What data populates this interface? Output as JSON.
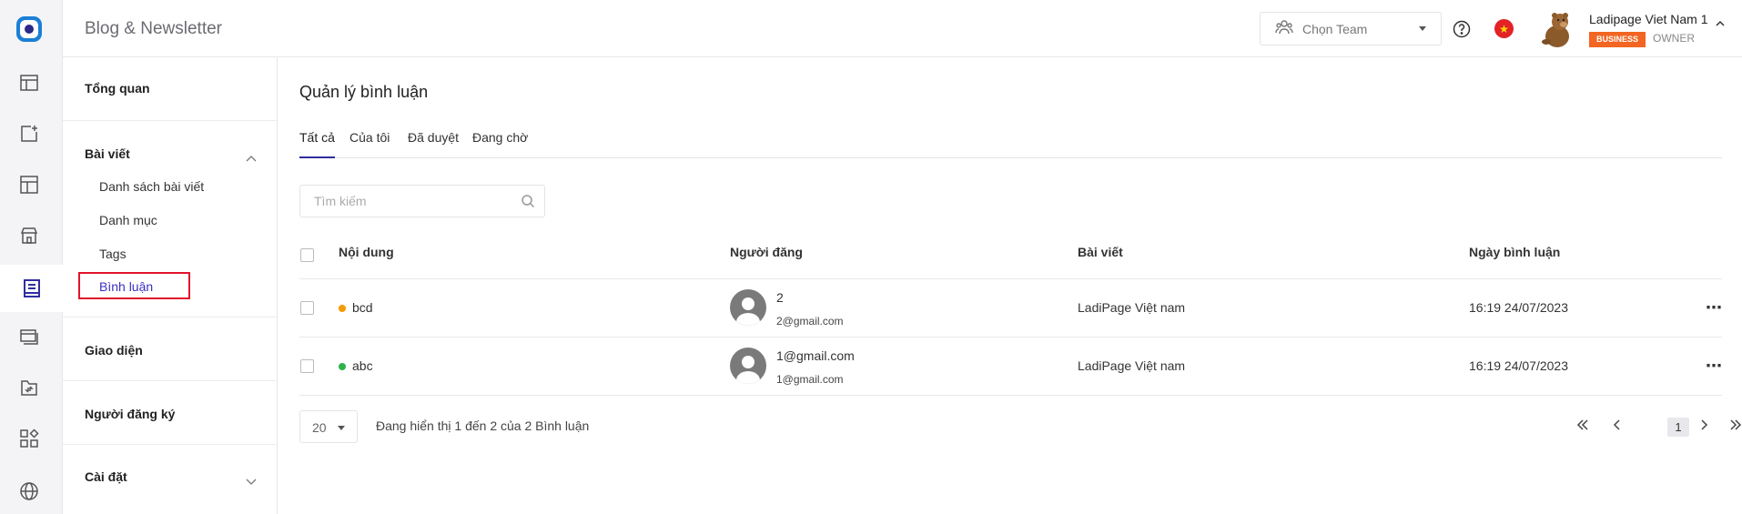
{
  "app": {
    "title": "Blog & Newsletter"
  },
  "topbar": {
    "team_label": "Chọn Team",
    "user_name": "Ladipage Viet Nam 1",
    "plan_badge": "BUSINESS",
    "role": "OWNER",
    "flag_icon": "vietnam-flag-icon"
  },
  "sidebar": {
    "overview": "Tổng quan",
    "posts_section": "Bài viết",
    "posts_items": [
      "Danh sách bài viết",
      "Danh mục",
      "Tags",
      "Bình luận"
    ],
    "active_item": "Bình luận",
    "theme": "Giao diện",
    "subscribers": "Người đăng ký",
    "settings": "Cài đặt"
  },
  "main": {
    "title": "Quản lý bình luận",
    "tabs": [
      "Tất cả",
      "Của tôi",
      "Đã duyệt",
      "Đang chờ"
    ],
    "active_tab": "Tất cả",
    "search_placeholder": "Tìm kiếm",
    "columns": [
      "Nội dung",
      "Người đăng",
      "Bài viết",
      "Ngày bình luận"
    ],
    "rows": [
      {
        "content": "bcd",
        "status_color": "#f59a00",
        "poster_name": "2",
        "poster_email": "2@gmail.com",
        "post": "LadiPage Việt nam",
        "date": "16:19 24/07/2023"
      },
      {
        "content": "abc",
        "status_color": "#2bb34a",
        "poster_name": "1@gmail.com",
        "poster_email": "1@gmail.com",
        "post": "LadiPage Việt nam",
        "date": "16:19 24/07/2023"
      }
    ],
    "per_page": "20",
    "showing_text": "Đang hiển thị 1 đến 2 của 2 Bình luận",
    "current_page": "1"
  },
  "colors": {
    "accent": "#3c2fc2",
    "highlight_box": "#e0142a",
    "business_badge": "#f26522"
  }
}
